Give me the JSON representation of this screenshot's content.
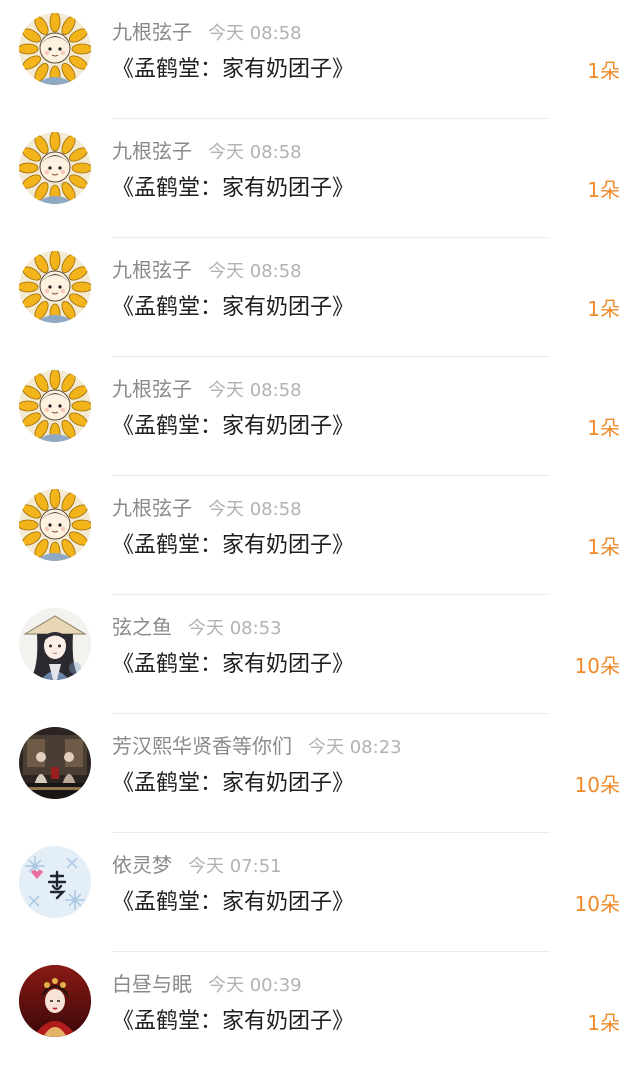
{
  "colors": {
    "name": "#8a8a8a",
    "time": "#b2b2b2",
    "title": "#1e1e1e",
    "count": "#f08a2b",
    "divider": "#ececec"
  },
  "records": [
    {
      "user": "九根弦子",
      "time": "今天 08:58",
      "gift": "《孟鹤堂：家有奶团子》",
      "count": "1朵",
      "avatar": "sunflower-avatar-icon"
    },
    {
      "user": "九根弦子",
      "time": "今天 08:58",
      "gift": "《孟鹤堂：家有奶团子》",
      "count": "1朵",
      "avatar": "sunflower-avatar-icon"
    },
    {
      "user": "九根弦子",
      "time": "今天 08:58",
      "gift": "《孟鹤堂：家有奶团子》",
      "count": "1朵",
      "avatar": "sunflower-avatar-icon"
    },
    {
      "user": "九根弦子",
      "time": "今天 08:58",
      "gift": "《孟鹤堂：家有奶团子》",
      "count": "1朵",
      "avatar": "sunflower-avatar-icon"
    },
    {
      "user": "九根弦子",
      "time": "今天 08:58",
      "gift": "《孟鹤堂：家有奶团子》",
      "count": "1朵",
      "avatar": "sunflower-avatar-icon"
    },
    {
      "user": "弦之鱼",
      "time": "今天 08:53",
      "gift": "《孟鹤堂：家有奶团子》",
      "count": "10朵",
      "avatar": "ancient-girl-avatar-icon"
    },
    {
      "user": "芳汉熙华贤香等你们",
      "time": "今天 08:23",
      "gift": "《孟鹤堂：家有奶团子》",
      "count": "10朵",
      "avatar": "stage-photo-avatar-icon"
    },
    {
      "user": "依灵梦",
      "time": "今天 07:51",
      "gift": "《孟鹤堂：家有奶团子》",
      "count": "10朵",
      "avatar": "dream-calligraphy-avatar-icon"
    },
    {
      "user": "白昼与眠",
      "time": "今天 00:39",
      "gift": "《孟鹤堂：家有奶团子》",
      "count": "1朵",
      "avatar": "red-costume-avatar-icon"
    }
  ]
}
